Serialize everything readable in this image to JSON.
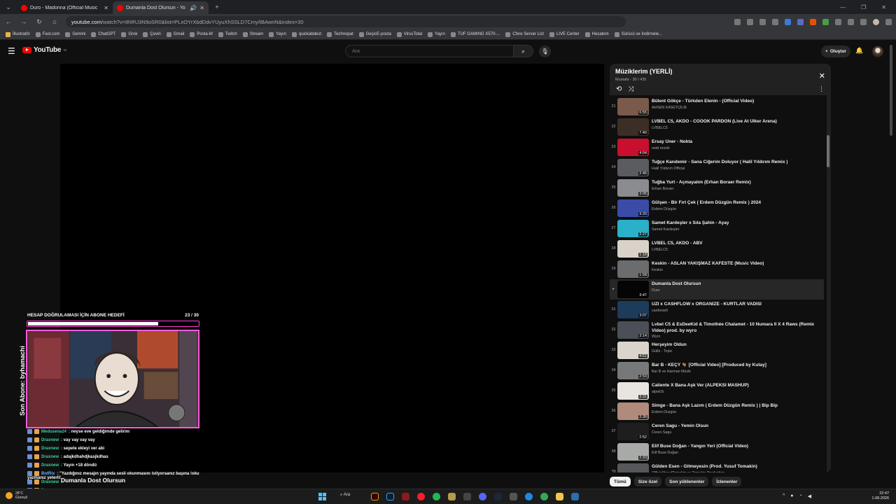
{
  "browser": {
    "tabs": [
      {
        "title": "Duro - Madonna (Official Music",
        "active": false
      },
      {
        "title": "Dumanla Dost Olursun - Yo",
        "active": true
      }
    ],
    "url_host": "youtube.com",
    "url_path": "/watch?v=9hRU3N9oSR0&list=PLxOYrXbdDdvYUyuXhSSLD7Cmy/tBAwnN&index=30",
    "bookmarks": [
      "İllustratör",
      "Fast.com",
      "Gemini",
      "ChatGPT",
      "Grok",
      "Çeviri",
      "Gmail",
      "Posta-M",
      "Twitch",
      "Stream",
      "Yayın",
      "quickabdest",
      "Technopat",
      "GeçicE-posta",
      "VirusTotal",
      "Yayın",
      "TUF GAMING X570-...",
      "Cfxre Server List",
      "LIVE Center",
      "Hesabım",
      "Sürücü ve İndirmele..."
    ]
  },
  "youtube": {
    "logo_text": "YouTube",
    "logo_region": "TR",
    "search_placeholder": "Ara",
    "create_label": "Oluştur"
  },
  "overlay": {
    "goal_title": "HESAP DOĞRULAMASI İÇİN ABONE HEDEFİ",
    "goal_count": "23 / 30",
    "goal_progress": 0.7667,
    "last_sub": "Son Abone: byhamachi",
    "chat": [
      {
        "user": "Medusena24",
        "msg": ": neyse eve geldiğimde gelirim",
        "bot": false
      },
      {
        "user": "Draxnew",
        "msg": ": vay vay vay vay",
        "bot": false
      },
      {
        "user": "Draxnew",
        "msg": ": sepete ekleyi ver abi",
        "bot": false
      },
      {
        "user": "Draxnew",
        "msg": ": adajkdhahdjkasjkdhas",
        "bot": false
      },
      {
        "user": "Draxnew",
        "msg": ": Yayın +18 döndü",
        "bot": false
      },
      {
        "user": "BotRix",
        "msg": ": \"Yazdığınız mesajın yayında sesli okunmasını istiyorsanız başına !oku",
        "bot": true
      },
      {
        "user": "Draxnew",
        "msg": ":",
        "bot": false
      },
      {
        "user": "Draxnew",
        "msg": ":",
        "bot": false
      }
    ],
    "chat_wrap": "yazmanız yeterli!",
    "now_playing": "Dumanla Dost Olursun"
  },
  "playlist": {
    "title": "Müziklerim (YERLİ)",
    "subtitle": "Mustafa - 30 / 435",
    "items": [
      {
        "idx": "21",
        "title": "Bülent Gökçe - Türkden Elenin - (Official Video)",
        "channel": "AHSEN KASETÇİLİK",
        "dur": "6:55",
        "color": "#7a5a4a"
      },
      {
        "idx": "22",
        "title": "LVBEL C5, AKDO - COOOK PARDON (Live At Ülker Arena)",
        "channel": "LVBELC5",
        "dur": "7:40",
        "color": "#3c2e26"
      },
      {
        "idx": "23",
        "title": "Ersay Üner - Nokta",
        "channel": "netd müzik",
        "dur": "4:04",
        "color": "#c8102e"
      },
      {
        "idx": "24",
        "title": "Tuğçe Kandemir - Sana Ciğerim Doluyor ( Halil Yıldırım Remix )",
        "channel": "Halil Yıldırım Official",
        "dur": "2:45",
        "color": "#5a5c60"
      },
      {
        "idx": "25",
        "title": "Tuğba Yurt - Açmayalım (Erhan Boraer Remix)",
        "channel": "Erhan Boraer",
        "dur": "3:05",
        "color": "#8a8c90"
      },
      {
        "idx": "26",
        "title": "Gülşen - Bir Fırt Çek ( Erdem Düzgün Remix ) 2024",
        "channel": "Erdem Düzgün",
        "dur": "3:20",
        "color": "#3a4ca8"
      },
      {
        "idx": "27",
        "title": "Samet Kardeşler x Sıla Şahin - Ayay",
        "channel": "Samet Kardeşler",
        "dur": "2:27",
        "color": "#2ab0c9"
      },
      {
        "idx": "28",
        "title": "LVBEL C5, AKDO - ABV",
        "channel": "LVBELC5",
        "dur": "1:18",
        "color": "#d8d2c8"
      },
      {
        "idx": "29",
        "title": "Keskin - ASLAN YAKIŞMAZ KAFESTE (Music Video)",
        "channel": "Keskin",
        "dur": "1:58",
        "color": "#6a6c6e"
      },
      {
        "idx": "",
        "title": "Dumanla Dost Olursun",
        "channel": "Duro",
        "dur": "3:47",
        "color": "#050505",
        "current": true
      },
      {
        "idx": "31",
        "title": "UZI x CASHFLOW x ORGANİZE - KURTLAR VADİSİ",
        "channel": "canforsell",
        "dur": "3:07",
        "color": "#1d3b5a"
      },
      {
        "idx": "32",
        "title": "Lvbel C5 & EsDeeKid & Timothée Chalamet - 10 Numara ll X 4 Raws (Remix Video) prod. by wyro",
        "channel": "Wyro",
        "dur": "3:14",
        "color": "#4a4f58"
      },
      {
        "idx": "33",
        "title": "Herşeyim Oldun",
        "channel": "Güllü - Topic",
        "dur": "4:51",
        "color": "#d9d4cc"
      },
      {
        "idx": "34",
        "title": "Bar B - KEÇY 🐐 [Official Video] [Produced by Kutay]",
        "channel": "Bar B ve Harman Müzik",
        "dur": "2:53",
        "color": "#77787a"
      },
      {
        "idx": "35",
        "title": "Caliente X Bana Aşk Ver (ALPEKSI MASHUP)",
        "channel": "alpekSi",
        "dur": "3:31",
        "color": "#e8e4e0"
      },
      {
        "idx": "36",
        "title": "Simge - Bana Aşk Lazım ( Erdem Düzgün Remix ) | Bip Bip",
        "channel": "Erdem Düzgün",
        "dur": "2:39",
        "color": "#b08a7a"
      },
      {
        "idx": "37",
        "title": "Ceren Sagu - Yemin Olsun",
        "channel": "Ceren Sagu",
        "dur": "2:52",
        "color": "#1e1e1e"
      },
      {
        "idx": "38",
        "title": "Elif Buse Doğan - Yangın Yeri (Official Video)",
        "channel": "Elif Buse Doğan",
        "dur": "2:33",
        "color": "#a8aaa8"
      },
      {
        "idx": "39",
        "title": "Gülden Esen - Gitmeyesin (Prod. Yusuf Tomakin)",
        "channel": "OfficialYusufTomakin ve Tomakin Production",
        "dur": "2:13",
        "color": "#55575a"
      }
    ]
  },
  "chips": [
    {
      "label": "Tümü",
      "selected": true
    },
    {
      "label": "Size özel",
      "selected": false
    },
    {
      "label": "Son yüklenenler",
      "selected": false
    },
    {
      "label": "İzlenenler",
      "selected": false
    }
  ],
  "taskbar": {
    "weather_temp": "28°C",
    "weather_desc": "Güneşli",
    "search_label": "Ara",
    "time": "22:47",
    "date": "1.08.2026"
  },
  "colors": {
    "accent": "#ff0000",
    "overlay_border": "#ff5bdc",
    "chat_user": "#34d399"
  }
}
